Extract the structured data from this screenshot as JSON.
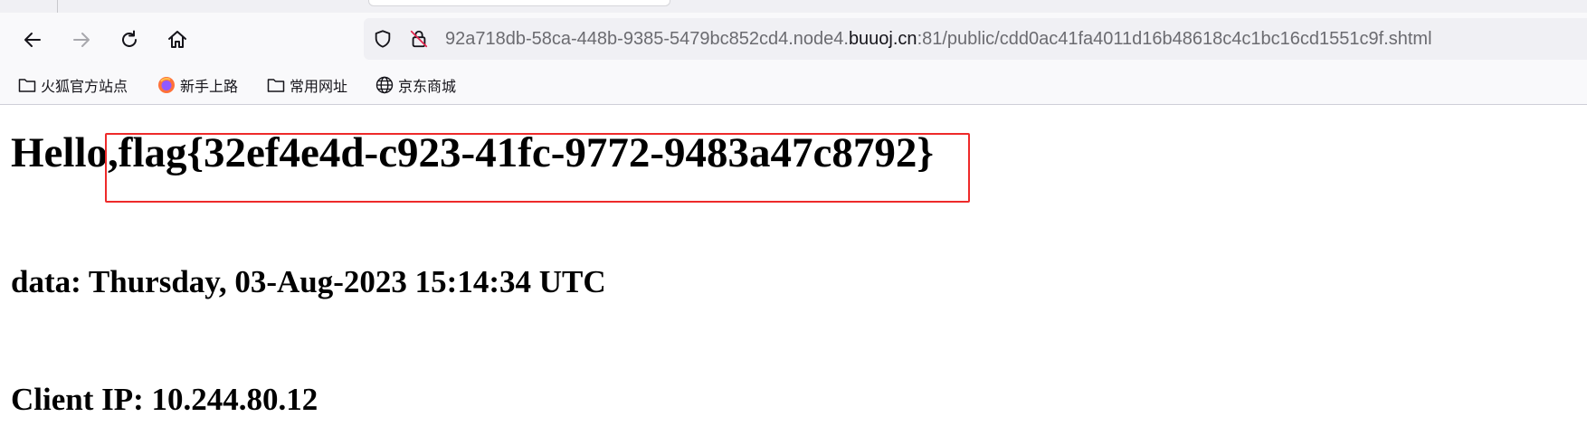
{
  "browser": {
    "url": {
      "prefix": "92a718db-58ca-448b-9385-5479bc852cd4.node4.",
      "domain": "buuoj.cn",
      "suffix": ":81/public/cdd0ac41fa4011d16b48618c4c1bc16cd1551c9f.shtml"
    },
    "nav_icons": [
      "back-arrow-icon",
      "forward-arrow-icon",
      "reload-icon",
      "home-icon"
    ],
    "bookmarks": [
      {
        "label": "火狐官方站点",
        "icon": "folder-icon"
      },
      {
        "label": "新手上路",
        "icon": "firefox-icon"
      },
      {
        "label": "常用网址",
        "icon": "folder-icon"
      },
      {
        "label": "京东商城",
        "icon": "globe-icon"
      }
    ]
  },
  "page": {
    "hello_prefix": "Hello",
    "flag": ",flag{32ef4e4d-c923-41fc-9772-9483a47c8792}",
    "date_line": "data: Thursday, 03-Aug-2023 15:14:34 UTC",
    "ip_line": "Client IP: 10.244.80.12"
  },
  "colors": {
    "highlight": "#ee2a2a",
    "urlbar_bg": "#f0f0f4",
    "toolbar_bg": "#f9f9fb"
  }
}
